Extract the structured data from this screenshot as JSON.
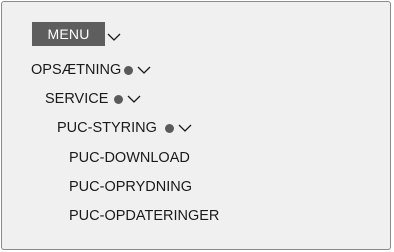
{
  "menu": {
    "title": "MENU",
    "items": [
      {
        "label": "OPSÆTNING",
        "expandable": true,
        "has_dot": true
      },
      {
        "label": "SERVICE",
        "expandable": true,
        "has_dot": true
      },
      {
        "label": "PUC-STYRING",
        "expandable": true,
        "has_dot": true
      },
      {
        "label": "PUC-DOWNLOAD"
      },
      {
        "label": "PUC-OPRYDNING"
      },
      {
        "label": "PUC-OPDATERINGER"
      }
    ]
  },
  "icons": {
    "expand": "chevron-down-icon",
    "indicator": "dot-indicator-icon"
  },
  "colors": {
    "background": "#f0f0f0",
    "border": "#8a8a8a",
    "menu_button": "#5e5e5e",
    "menu_text": "#ffffff",
    "text": "#1a1a1a",
    "dot": "#5a5a5a"
  }
}
